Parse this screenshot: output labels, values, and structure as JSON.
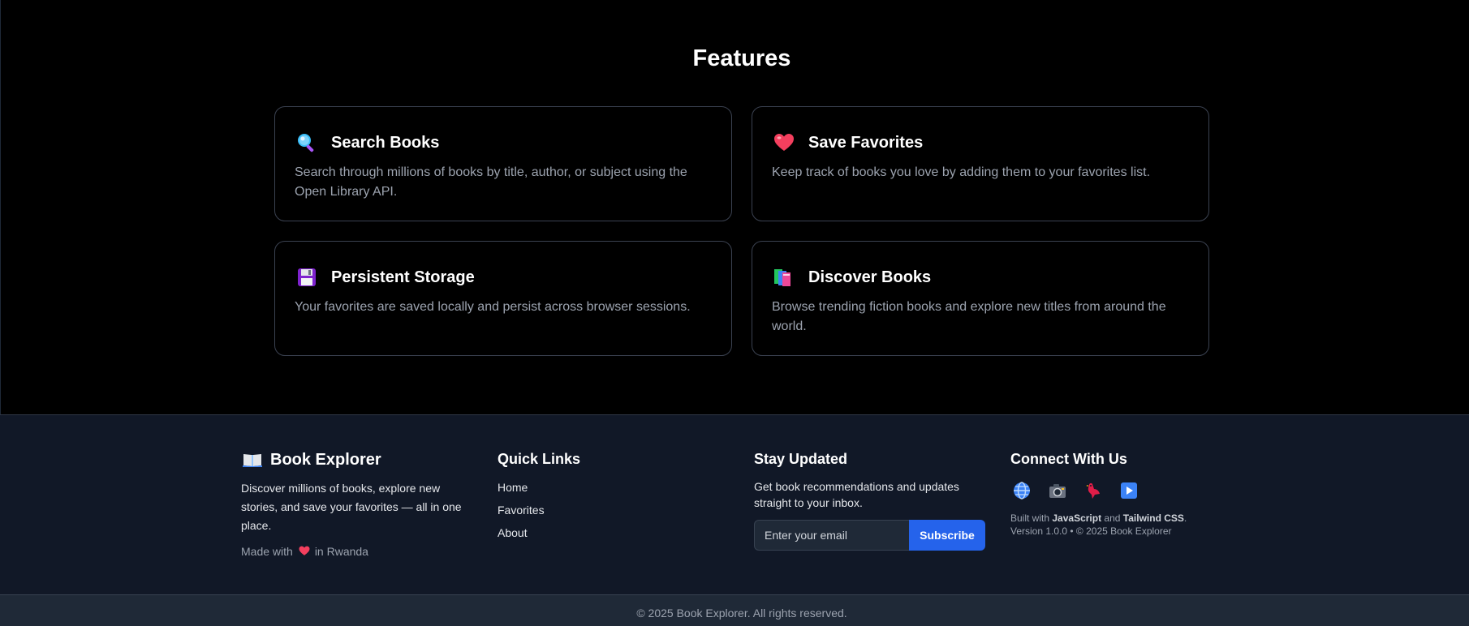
{
  "features": {
    "title": "Features",
    "cards": [
      {
        "icon": "magnifier-icon",
        "title": "Search Books",
        "description": "Search through millions of books by title, author, or subject using the Open Library API."
      },
      {
        "icon": "heart-icon",
        "title": "Save Favorites",
        "description": "Keep track of books you love by adding them to your favorites list."
      },
      {
        "icon": "floppy-disk-icon",
        "title": "Persistent Storage",
        "description": "Your favorites are saved locally and persist across browser sessions."
      },
      {
        "icon": "books-icon",
        "title": "Discover Books",
        "description": "Browse trending fiction books and explore new titles from around the world."
      }
    ]
  },
  "footer": {
    "brand": {
      "icon": "open-book-icon",
      "title": "Book Explorer",
      "description": "Discover millions of books, explore new stories, and save your favorites — all in one place.",
      "made_with_prefix": "Made with",
      "made_with_suffix": "in Rwanda"
    },
    "quick_links": {
      "title": "Quick Links",
      "links": [
        "Home",
        "Favorites",
        "About"
      ]
    },
    "stay_updated": {
      "title": "Stay Updated",
      "description": "Get book recommendations and updates straight to your inbox.",
      "email_placeholder": "Enter your email",
      "subscribe_label": "Subscribe"
    },
    "connect": {
      "title": "Connect With Us",
      "socials": [
        "globe-icon",
        "camera-icon",
        "bird-icon",
        "play-icon"
      ],
      "built_prefix": "Built with",
      "built_js": "JavaScript",
      "built_and": "and",
      "built_css": "Tailwind CSS",
      "built_end": ".",
      "version": "Version 1.0.0 • © 2025 Book Explorer"
    },
    "copyright": "© 2025 Book Explorer. All rights reserved."
  },
  "colors": {
    "background": "#000000",
    "footer_background": "#111827",
    "accent": "#2563eb",
    "muted_text": "#9ca3af"
  }
}
